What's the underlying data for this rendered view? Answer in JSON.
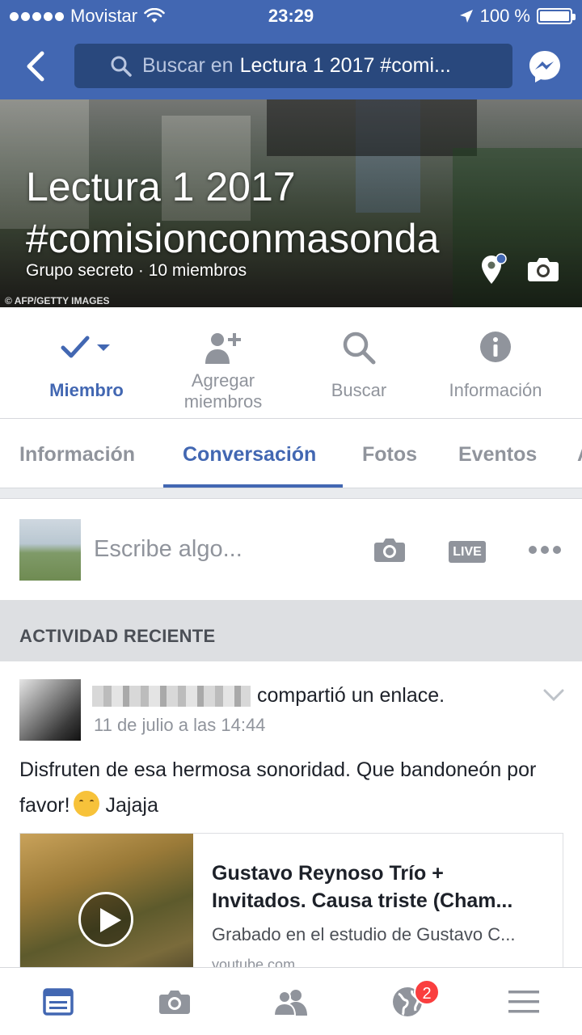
{
  "status_bar": {
    "carrier": "Movistar",
    "time": "23:29",
    "battery": "100 %"
  },
  "nav": {
    "search_prefix": "Buscar en",
    "search_term": "Lectura 1 2017 #comi..."
  },
  "group": {
    "title_line1": "Lectura 1 2017",
    "title_line2": "#comisionconmasonda",
    "meta": "Grupo secreto · 10 miembros",
    "photo_credit": "© AFP/GETTY IMAGES"
  },
  "actions": {
    "member": "Miembro",
    "add_line1": "Agregar",
    "add_line2": "miembros",
    "search": "Buscar",
    "info": "Información"
  },
  "tabs": [
    {
      "label": "Información"
    },
    {
      "label": "Conversación"
    },
    {
      "label": "Fotos"
    },
    {
      "label": "Eventos"
    },
    {
      "label": "A"
    }
  ],
  "composer": {
    "placeholder": "Escribe algo...",
    "live": "LIVE"
  },
  "recent_header": "ACTIVIDAD RECIENTE",
  "post": {
    "action": "compartió un enlace.",
    "date": "11 de julio a las 14:44",
    "text_part1": "Disfruten de esa hermosa sonoridad. Que bandoneón por favor!",
    "text_part2": "Jajaja",
    "link": {
      "title_line1": "Gustavo Reynoso Trío +",
      "title_line2": "Invitados. Causa triste (Cham...",
      "description": "Grabado en el estudio de Gustavo C...",
      "domain": "youtube.com"
    }
  },
  "bottom_nav": {
    "notifications_badge": "2"
  },
  "colors": {
    "brand": "#4267b2",
    "search_bg": "#29487d",
    "muted": "#90949c",
    "badge": "#fa3e3e"
  }
}
